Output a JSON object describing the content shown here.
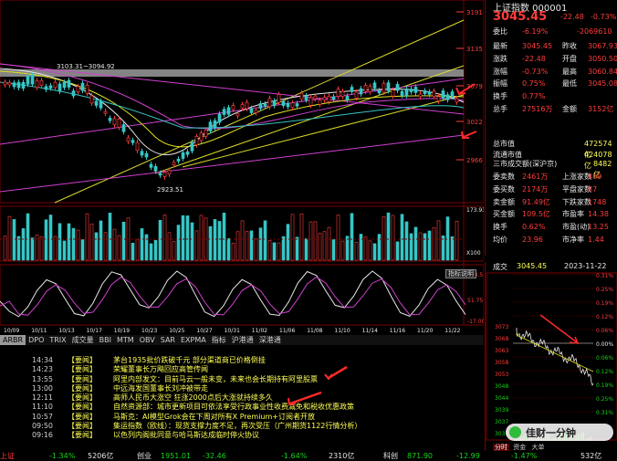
{
  "header": {
    "index_name": "上证指数 000001",
    "price": "3045.45",
    "change": "-22.48",
    "pct": "-0.73%"
  },
  "quote": {
    "weibi_label": "委比",
    "weibi_pct": "-6.19%",
    "weibi_val": "-2069610",
    "rows": [
      {
        "l": "最新",
        "v": "3045.45",
        "r": "昨收",
        "rv": "3067.93"
      },
      {
        "l": "涨跌",
        "v": "-22.48",
        "r": "开盘",
        "rv": "3050.50"
      },
      {
        "l": "涨幅",
        "v": "-0.73%",
        "r": "最高",
        "rv": "3060.84"
      },
      {
        "l": "振幅",
        "v": "0.75%",
        "r": "最低",
        "rv": "3045.08"
      },
      {
        "l": "换手",
        "v": "0.77%",
        "r": "",
        "rv": ""
      },
      {
        "l": "总手",
        "v": "27516万",
        "r": "金额",
        "rv": "3152亿"
      }
    ],
    "market_value_label": "总市值",
    "market_value": "472574亿",
    "float_value_label": "流通市值",
    "float_value": "424078亿",
    "three_label": "三市成交额(深沪京)",
    "three_value": "8482亿",
    "rows2": [
      {
        "l": "委卖数",
        "v": "2461万",
        "r": "上涨家数",
        "rv": "460"
      },
      {
        "l": "委买数",
        "v": "2174万",
        "r": "平盘家数",
        "rv": "87"
      },
      {
        "l": "卖金额",
        "v": "91.49亿",
        "r": "下跌家数",
        "rv": "1748"
      },
      {
        "l": "买金额",
        "v": "109.5亿",
        "r": "市盈率",
        "rv": "14.38"
      },
      {
        "l": "换手",
        "v": "0.62%",
        "r": "市盈(动)",
        "rv": "13.25"
      },
      {
        "l": "均价",
        "v": "23.96",
        "r": "市净率",
        "rv": "1.44"
      }
    ]
  },
  "chart": {
    "price_labels": [
      "3191",
      "3135",
      "3079",
      "3022",
      "2966"
    ],
    "annotations": {
      "high": "3103.31~3094.92",
      "low": "2923.51"
    },
    "vol_labels": [
      "173.93亿",
      "X100"
    ],
    "osc_labels": [
      "120.5",
      "51.75",
      "-17.00"
    ],
    "indicator_button": "指标说明",
    "dates": [
      "10/09",
      "10/11",
      "10/13",
      "10/17",
      "10/19",
      "10/23",
      "10/25",
      "10/27",
      "10/31",
      "11/02",
      "11/06",
      "11/08",
      "11/10",
      "11/14",
      "11/16",
      "11/20",
      "11/22"
    ],
    "tabs": [
      "ARBR",
      "DPO",
      "TRIX",
      "成交量",
      "BBI",
      "MTM",
      "OBV",
      "SAR",
      "EXPMA",
      "指标",
      "沪港通",
      "深港通"
    ]
  },
  "news": [
    {
      "time": "14:34",
      "src": "【要闻】",
      "text": "茅台1935批价跌破千元 部分渠道商已价格倒挂"
    },
    {
      "time": "14:23",
      "src": "【要闻】",
      "text": "荣耀董事长万飚回应高管传闻"
    },
    {
      "time": "13:55",
      "src": "【要闻】",
      "text": "阿里内部发文：目前马云一般未变，未来也会长期持有阿里股票"
    },
    {
      "time": "13:00",
      "src": "【要闻】",
      "text": "中远海发国董事长刘冲被带走"
    },
    {
      "time": "12:11",
      "src": "【要闻】",
      "text": "高师人民币大涨空 狂涨2000点后大涨就持续多久"
    },
    {
      "time": "11:10",
      "src": "【要闻】",
      "text": "自然资源部：城市更新项目可依法享受行政事业性收费减免和税收优惠政策"
    },
    {
      "time": "10:57",
      "src": "【要闻】",
      "text": "马斯克：AI模型Grok会在下周对所有X Premium+订阅者开放"
    },
    {
      "time": "09:50",
      "src": "【要闻】",
      "text": "集运指数（欧线）：现货支撑力度不足，再次受压（广州期货1122行情分析）"
    },
    {
      "time": "09:16",
      "src": "【要闻】",
      "text": "以色列内阁批同意与哈马斯达成临时停火协议"
    }
  ],
  "intraday": {
    "label": "成交",
    "price": "3045.45",
    "date": "2023-11-22",
    "left_prices": [
      "3073",
      "3068",
      "3063",
      "3058",
      "3053",
      "3048",
      "3044",
      "3039",
      "3037",
      "3031"
    ],
    "right_pcts": [
      "0.31%",
      "0.25%",
      "0.19%",
      "0.12%",
      "0.06%",
      "0.00%",
      "0.06%",
      "0.12%",
      "0.19%",
      "0.25%",
      "0.31%"
    ],
    "tabs": [
      "分时",
      "资金",
      "大单"
    ],
    "watermark": "佳财一分钟"
  },
  "bottom": {
    "items": [
      "上证",
      "-1.34%",
      "5206亿",
      "创业",
      "1951.01",
      "-32.46",
      "-1.64%",
      "2310亿",
      "科创",
      "871.90",
      "-12.99",
      "-1.47%",
      "532亿"
    ]
  }
}
